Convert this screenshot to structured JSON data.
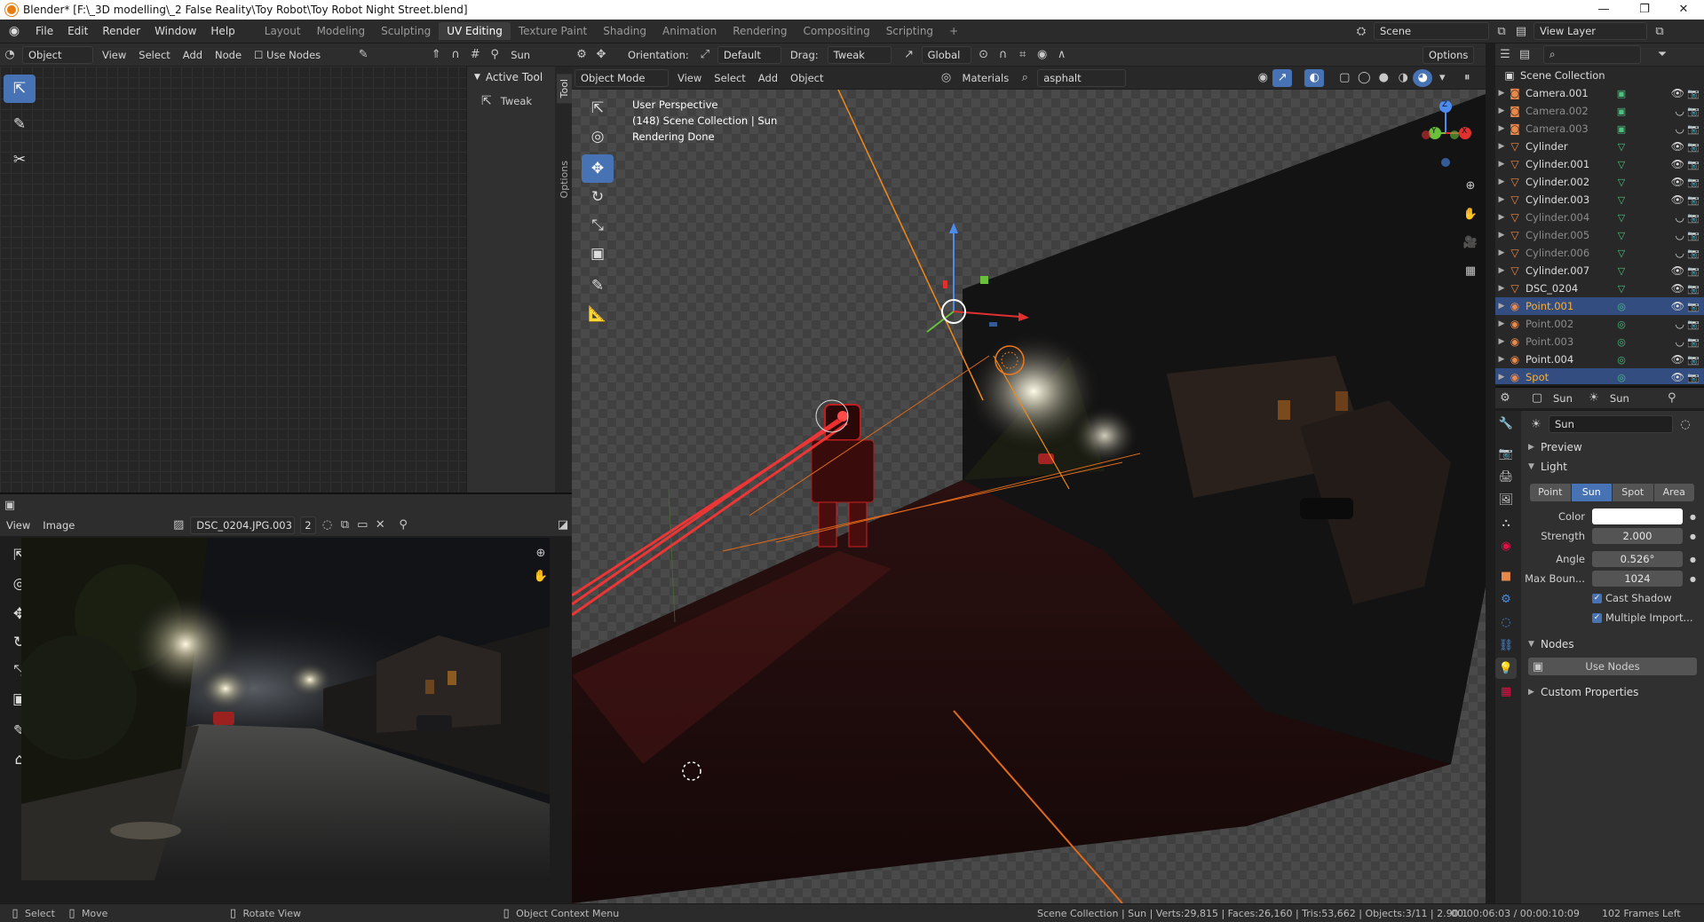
{
  "window": {
    "title": "Blender* [F:\\_3D modelling\\_2 False Reality\\Toy Robot\\Toy Robot Night Street.blend]",
    "min": "—",
    "max": "❐",
    "close": "✕"
  },
  "menu": [
    "File",
    "Edit",
    "Render",
    "Window",
    "Help"
  ],
  "workspaces": [
    "Layout",
    "Modeling",
    "Sculpting",
    "UV Editing",
    "Texture Paint",
    "Shading",
    "Animation",
    "Rendering",
    "Compositing",
    "Scripting"
  ],
  "workspace_add": "+",
  "scene": {
    "label": "Scene",
    "view_layer": "View Layer"
  },
  "node_editor": {
    "type_label": "Object",
    "menus": [
      "View",
      "Select",
      "Add",
      "Node"
    ],
    "use_nodes": "Use Nodes",
    "light_name": "Sun",
    "active_tool_header": "Active Tool",
    "active_tool": "Tweak",
    "side_tabs": [
      "Tool",
      "Options"
    ]
  },
  "image_editor": {
    "menus": [
      "View",
      "Image"
    ],
    "image_name": "DSC_0204.JPG.003",
    "users": "2"
  },
  "viewport_header": {
    "orientation_label": "Orientation:",
    "orientation": "Default",
    "drag_label": "Drag:",
    "drag": "Tweak",
    "transform": "Global",
    "options": "Options"
  },
  "viewport": {
    "mode": "Object Mode",
    "menus": [
      "View",
      "Select",
      "Add",
      "Object"
    ],
    "material_mode": "Materials",
    "material_search": "asphalt",
    "info": [
      "User Perspective",
      "(148) Scene Collection | Sun",
      "Rendering Done"
    ],
    "gizmo_axes": [
      "Z",
      "Y",
      "X"
    ]
  },
  "outliner": {
    "root": "Scene Collection",
    "items": [
      {
        "name": "Camera.001",
        "icon": "camera-icon",
        "dim": false,
        "sel": false,
        "vis": true
      },
      {
        "name": "Camera.002",
        "icon": "camera-icon",
        "dim": true,
        "sel": false,
        "vis": false
      },
      {
        "name": "Camera.003",
        "icon": "camera-icon",
        "dim": true,
        "sel": false,
        "vis": false
      },
      {
        "name": "Cylinder",
        "icon": "mesh-icon",
        "dim": false,
        "sel": false,
        "vis": true
      },
      {
        "name": "Cylinder.001",
        "icon": "mesh-icon",
        "dim": false,
        "sel": false,
        "vis": true
      },
      {
        "name": "Cylinder.002",
        "icon": "mesh-icon",
        "dim": false,
        "sel": false,
        "vis": true
      },
      {
        "name": "Cylinder.003",
        "icon": "mesh-icon",
        "dim": false,
        "sel": false,
        "vis": true
      },
      {
        "name": "Cylinder.004",
        "icon": "mesh-icon",
        "dim": true,
        "sel": false,
        "vis": false
      },
      {
        "name": "Cylinder.005",
        "icon": "mesh-icon",
        "dim": true,
        "sel": false,
        "vis": false
      },
      {
        "name": "Cylinder.006",
        "icon": "mesh-icon",
        "dim": true,
        "sel": false,
        "vis": false
      },
      {
        "name": "Cylinder.007",
        "icon": "mesh-icon",
        "dim": false,
        "sel": false,
        "vis": true
      },
      {
        "name": "DSC_0204",
        "icon": "mesh-icon",
        "dim": false,
        "sel": false,
        "vis": true
      },
      {
        "name": "Point.001",
        "icon": "light-icon",
        "dim": false,
        "sel": true,
        "vis": true
      },
      {
        "name": "Point.002",
        "icon": "light-icon",
        "dim": true,
        "sel": false,
        "vis": false
      },
      {
        "name": "Point.003",
        "icon": "light-icon",
        "dim": true,
        "sel": false,
        "vis": false
      },
      {
        "name": "Point.004",
        "icon": "light-icon",
        "dim": false,
        "sel": false,
        "vis": true
      },
      {
        "name": "Spot",
        "icon": "light-icon",
        "dim": false,
        "sel": true,
        "vis": true
      }
    ]
  },
  "properties": {
    "breadcrumb_obj": "Sun",
    "breadcrumb_data": "Sun",
    "datablock": "Sun",
    "sections": {
      "preview": "Preview",
      "light": "Light",
      "nodes": "Nodes",
      "custom": "Custom Properties"
    },
    "light_types": [
      "Point",
      "Sun",
      "Spot",
      "Area"
    ],
    "active_light_type": "Sun",
    "fields": [
      {
        "label": "Color",
        "value": "",
        "kind": "color"
      },
      {
        "label": "Strength",
        "value": "2.000",
        "kind": "num"
      },
      {
        "label": "Angle",
        "value": "0.526°",
        "kind": "num"
      },
      {
        "label": "Max Boun...",
        "value": "1024",
        "kind": "num"
      }
    ],
    "cast_shadow": "Cast Shadow",
    "multiple_import": "Multiple Import...",
    "use_nodes": "Use Nodes"
  },
  "statusbar": {
    "select": "Select",
    "move": "Move",
    "rotate": "Rotate View",
    "context": "Object Context Menu",
    "stats": "Scene Collection | Sun | Verts:29,815 | Faces:26,160 | Tris:53,662 | Objects:3/11 | 2.90.1",
    "time": "00:00:06:03 / 00:00:10:09",
    "frames": "102 Frames Left"
  },
  "colors": {
    "accent": "#4772b3",
    "orange": "#e87d0d",
    "selected_text": "#ffaf29"
  }
}
